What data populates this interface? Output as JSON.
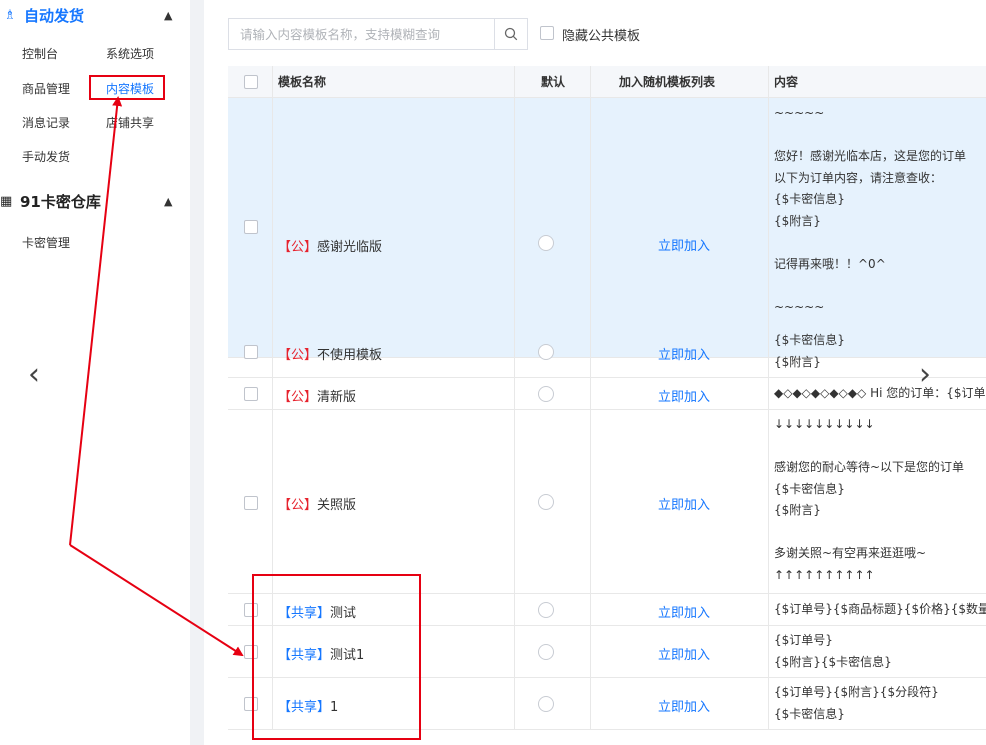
{
  "sidebar": {
    "section1": {
      "title": "自动发货",
      "icon": "robot-icon"
    },
    "section1_items": [
      "控制台",
      "系统选项",
      "商品管理",
      "内容模板",
      "消息记录",
      "店铺共享",
      "手动发货"
    ],
    "section2": {
      "title": "91卡密仓库",
      "icon": "grid-icon"
    },
    "section2_items": [
      "卡密管理"
    ]
  },
  "search": {
    "placeholder": "请输入内容模板名称，支持模糊查询"
  },
  "filter": {
    "hide_public_label": "隐藏公共模板"
  },
  "table": {
    "headers": {
      "name": "模板名称",
      "default": "默认",
      "random": "加入随机模板列表",
      "content": "内容"
    },
    "rows": [
      {
        "tag": "【公】",
        "name": "感谢光临版",
        "action": "立即加入",
        "content": "~~~~~\n\n您好！感谢光临本店，这是您的订单\n以下为订单内容，请注意查收：\n{$卡密信息}\n{$附言}\n\n记得再来哦！！^0^\n\n~~~~~"
      },
      {
        "tag": "【公】",
        "name": "不使用模板",
        "action": "立即加入",
        "content": "{$卡密信息}\n{$附言}"
      },
      {
        "tag": "【公】",
        "name": "清新版",
        "action": "立即加入",
        "content": "◆◇◆◇◆◇◆◇◆◇ Hi 您的订单：{$订单号}"
      },
      {
        "tag": "【公】",
        "name": "关照版",
        "action": "立即加入",
        "content": "↓↓↓↓↓↓↓↓↓↓\n\n感谢您的耐心等待~以下是您的订单\n{$卡密信息}\n{$附言}\n\n多谢关照~有空再来逛逛哦~\n↑↑↑↑↑↑↑↑↑↑"
      },
      {
        "tag": "【共享】",
        "name": "测试",
        "action": "立即加入",
        "content": "{$订单号}{$商品标题}{$价格}{$数量}"
      },
      {
        "tag": "【共享】",
        "name": "测试1",
        "action": "立即加入",
        "content": "{$订单号}\n{$附言}{$卡密信息}"
      },
      {
        "tag": "【共享】",
        "name": "1",
        "action": "立即加入",
        "content": "{$订单号}{$附言}{$分段符}\n{$卡密信息}"
      }
    ]
  },
  "colors": {
    "accent": "#1677ff",
    "public_tag": "#e6222d",
    "annotation": "#e60012",
    "selected_row": "#e6f2fd"
  }
}
